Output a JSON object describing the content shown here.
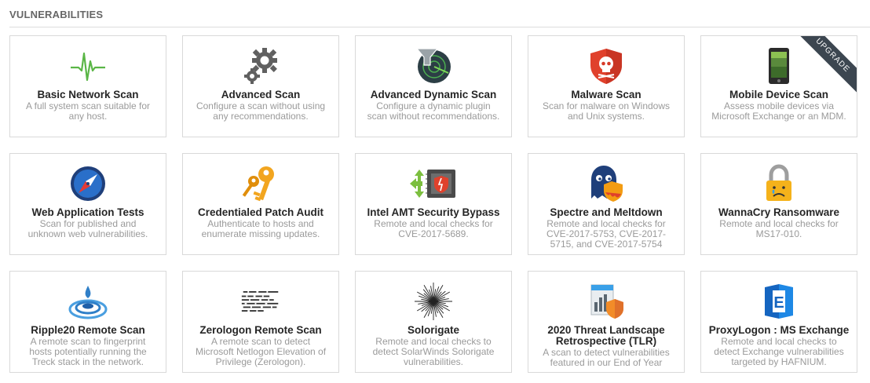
{
  "section": {
    "title": "VULNERABILITIES"
  },
  "templates": [
    {
      "title": "Basic Network Scan",
      "desc": "A full system scan suitable for any host.",
      "icon": "pulse-icon"
    },
    {
      "title": "Advanced Scan",
      "desc": "Configure a scan without using any recommendations.",
      "icon": "gears-icon"
    },
    {
      "title": "Advanced Dynamic Scan",
      "desc": "Configure a dynamic plugin scan without recommendations.",
      "icon": "radar-funnel-icon"
    },
    {
      "title": "Malware Scan",
      "desc": "Scan for malware on Windows and Unix systems.",
      "icon": "skull-shield-icon"
    },
    {
      "title": "Mobile Device Scan",
      "desc": "Assess mobile devices via Microsoft Exchange or an MDM.",
      "icon": "mobile-phone-icon",
      "badge": "UPGRADE"
    },
    {
      "title": "Web Application Tests",
      "desc": "Scan for published and unknown web vulnerabilities.",
      "icon": "compass-icon"
    },
    {
      "title": "Credentialed Patch Audit",
      "desc": "Authenticate to hosts and enumerate missing updates.",
      "icon": "keys-icon"
    },
    {
      "title": "Intel AMT Security Bypass",
      "desc": "Remote and local checks for CVE-2017-5689.",
      "icon": "chip-shield-icon"
    },
    {
      "title": "Spectre and Meltdown",
      "desc": "Remote and local checks for CVE-2017-5753, CVE-2017-5715, and CVE-2017-5754",
      "icon": "ghost-shield-icon"
    },
    {
      "title": "WannaCry Ransomware",
      "desc": "Remote and local checks for MS17-010.",
      "icon": "padlock-icon"
    },
    {
      "title": "Ripple20 Remote Scan",
      "desc": "A remote scan to fingerprint hosts potentially running the Treck stack in the network.",
      "icon": "ripple-icon"
    },
    {
      "title": "Zerologon Remote Scan",
      "desc": "A remote scan to detect Microsoft Netlogon Elevation of Privilege (Zerologon).",
      "icon": "binary-text-icon"
    },
    {
      "title": "Solorigate",
      "desc": "Remote and local checks to detect SolarWinds Solorigate vulnerabilities.",
      "icon": "starburst-icon"
    },
    {
      "title": "2020 Threat Landscape Retrospective (TLR)",
      "desc": "A scan to detect vulnerabilities featured in our End of Year",
      "icon": "report-shield-icon"
    },
    {
      "title": "ProxyLogon : MS Exchange",
      "desc": "Remote and local checks to detect Exchange vulnerabilities targeted by HAFNIUM.",
      "icon": "exchange-icon"
    }
  ]
}
